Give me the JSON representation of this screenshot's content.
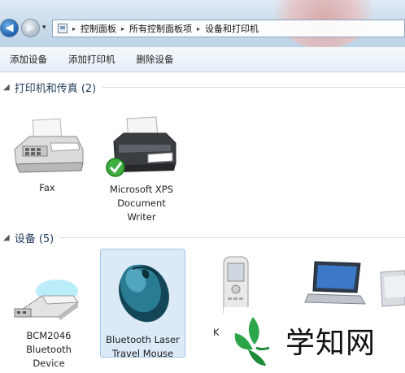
{
  "nav": {
    "history_arrow": "▾"
  },
  "breadcrumb": {
    "items": [
      "控制面板",
      "所有控制面板项",
      "设备和打印机"
    ],
    "separator": "▸"
  },
  "toolbar": {
    "buttons": [
      "添加设备",
      "添加打印机",
      "删除设备"
    ]
  },
  "groups": {
    "printers": {
      "title": "打印机和传真 (2)",
      "items": [
        {
          "label_lines": [
            "Fax"
          ],
          "icon": "fax-icon"
        },
        {
          "label_lines": [
            "Microsoft XPS",
            "Document",
            "Writer"
          ],
          "icon": "printer-default-icon",
          "default": true
        }
      ]
    },
    "devices": {
      "title": "设备 (5)",
      "items": [
        {
          "label_lines": [
            "BCM2046",
            "Bluetooth",
            "Device"
          ],
          "icon": "usb-bluetooth-dongle-icon"
        },
        {
          "label_lines": [
            "Bluetooth Laser",
            "Travel Mouse"
          ],
          "icon": "mouse-icon",
          "selected": true
        },
        {
          "label_lines": [
            "K"
          ],
          "icon": "phone-icon"
        },
        {
          "label_lines": [],
          "icon": "laptop-icon"
        },
        {
          "label_lines": [],
          "icon": "device-icon"
        }
      ]
    }
  },
  "watermark": {
    "text": "学知网"
  },
  "colors": {
    "address_bar": "#c9dceb",
    "toolbar": "#e6eef7",
    "group_title": "#1e395b",
    "selection_bg": "#dceaf8",
    "selection_border": "#9fc3e8",
    "mouse_body": "#1f5f78",
    "watermark_green": "#2aa54a"
  }
}
